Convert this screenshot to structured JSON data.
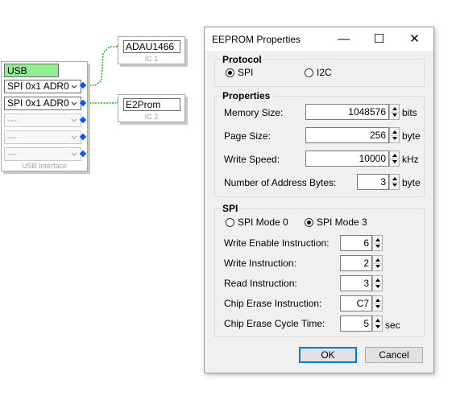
{
  "schematic": {
    "usb_block": {
      "title": "USB",
      "caption": "USB Interface",
      "ports": [
        {
          "label": "SPI 0x1 ADR0",
          "enabled": true
        },
        {
          "label": "SPI 0x1 ADR0",
          "enabled": true
        },
        {
          "label": "---",
          "enabled": false
        },
        {
          "label": "---",
          "enabled": false
        },
        {
          "label": "---",
          "enabled": false
        }
      ]
    },
    "ic1": {
      "name": "ADAU1466",
      "caption": "IC 1"
    },
    "ic2": {
      "name": "E2Prom",
      "caption": "IC 2"
    },
    "colors": {
      "usb_title_bg": "#90ee90",
      "wire": "#22aa22",
      "pin": "#0055ff"
    }
  },
  "dialog": {
    "title": "EEPROM Properties",
    "titlebar_buttons": {
      "minimize": "—",
      "maximize": "☐",
      "close": "✕"
    },
    "protocol": {
      "label": "Protocol",
      "options": [
        {
          "label": "SPI",
          "selected": true
        },
        {
          "label": "I2C",
          "selected": false
        }
      ]
    },
    "properties": {
      "label": "Properties",
      "memory_size": {
        "label": "Memory Size:",
        "value": "1048576",
        "unit": "bits"
      },
      "page_size": {
        "label": "Page Size:",
        "value": "256",
        "unit": "byte"
      },
      "write_speed": {
        "label": "Write Speed:",
        "value": "10000",
        "unit": "kHz"
      },
      "address_bytes": {
        "label": "Number of Address Bytes:",
        "value": "3",
        "unit": "byte"
      }
    },
    "spi": {
      "label": "SPI",
      "modes": [
        {
          "label": "SPI Mode 0",
          "selected": false
        },
        {
          "label": "SPI Mode 3",
          "selected": true
        }
      ],
      "write_enable": {
        "label": "Write Enable Instruction:",
        "value": "6"
      },
      "write": {
        "label": "Write Instruction:",
        "value": "2"
      },
      "read": {
        "label": "Read Instruction:",
        "value": "3"
      },
      "chip_erase": {
        "label": "Chip Erase Instruction:",
        "value": "C7"
      },
      "chip_erase_time": {
        "label": "Chip Erase Cycle Time:",
        "value": "5",
        "unit": "sec"
      }
    },
    "buttons": {
      "ok": "OK",
      "cancel": "Cancel"
    }
  }
}
